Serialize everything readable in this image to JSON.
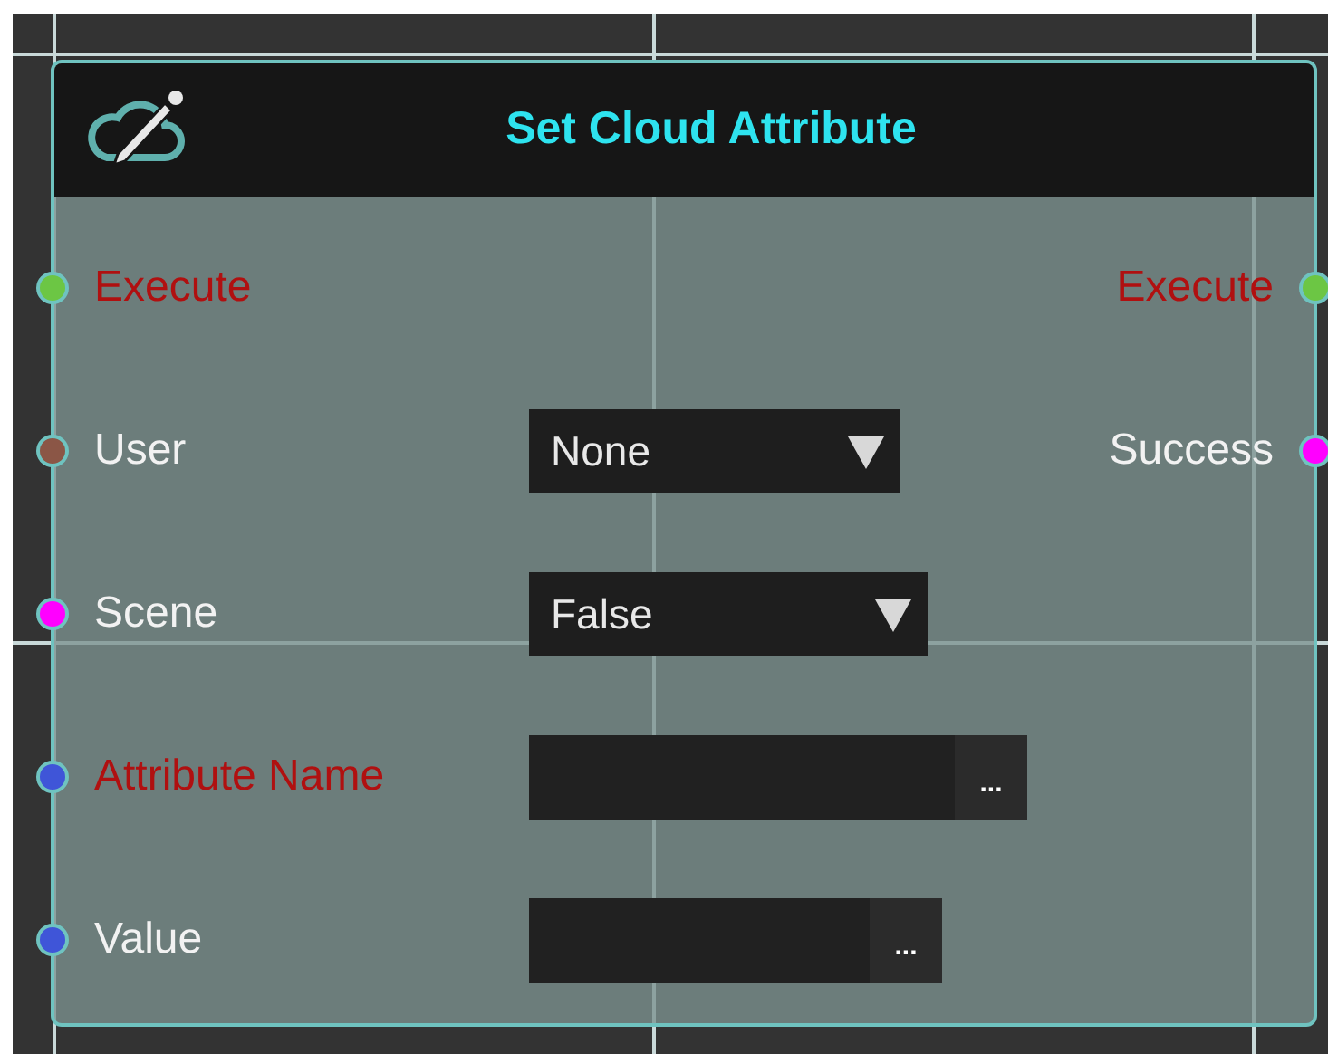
{
  "node": {
    "title": "Set Cloud Attribute",
    "inputs": [
      {
        "label": "Execute",
        "kind": "exec",
        "required": true,
        "color": "#6cc644"
      },
      {
        "label": "User",
        "kind": "dropdown",
        "required": false,
        "color": "#8b5646",
        "value": "None"
      },
      {
        "label": "Scene",
        "kind": "dropdown",
        "required": false,
        "color": "#ff00ff",
        "value": "False"
      },
      {
        "label": "Attribute Name",
        "kind": "text",
        "required": true,
        "color": "#3f55d8",
        "button": "..."
      },
      {
        "label": "Value",
        "kind": "text",
        "required": false,
        "color": "#3f55d8",
        "button": "..."
      }
    ],
    "outputs": [
      {
        "label": "Execute",
        "required": true,
        "color": "#6cc644"
      },
      {
        "label": "Success",
        "required": false,
        "color": "#ff00ff"
      }
    ]
  }
}
